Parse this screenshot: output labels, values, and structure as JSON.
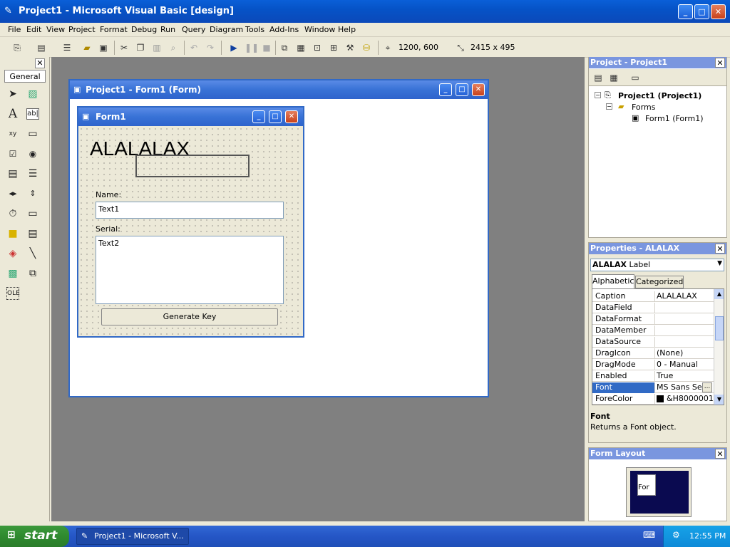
{
  "window": {
    "title": "Project1 - Microsoft Visual Basic [design]"
  },
  "menu": [
    "File",
    "Edit",
    "View",
    "Project",
    "Format",
    "Debug",
    "Run",
    "Query",
    "Diagram",
    "Tools",
    "Add-Ins",
    "Window",
    "Help"
  ],
  "toolbar": {
    "position": "1200, 600",
    "size": "2415 x 495"
  },
  "toolbox": {
    "tab_label": "General"
  },
  "designer": {
    "title": "Project1 - Form1 (Form)"
  },
  "form": {
    "title": "Form1",
    "big_label": "ALALALAX",
    "name_label": "Name:",
    "text1": "Text1",
    "serial_label": "Serial:",
    "text2": "Text2",
    "button": "Generate Key"
  },
  "project_explorer": {
    "title": "Project - Project1",
    "root": "Project1 (Project1)",
    "folder": "Forms",
    "item": "Form1 (Form1)"
  },
  "properties": {
    "title": "Properties - ALALAX",
    "object_name": "ALALAX",
    "object_type": "Label",
    "tab_alpha": "Alphabetic",
    "tab_cat": "Categorized",
    "rows": [
      {
        "name": "Caption",
        "value": "ALALALAX"
      },
      {
        "name": "DataField",
        "value": ""
      },
      {
        "name": "DataFormat",
        "value": ""
      },
      {
        "name": "DataMember",
        "value": ""
      },
      {
        "name": "DataSource",
        "value": ""
      },
      {
        "name": "DragIcon",
        "value": "(None)"
      },
      {
        "name": "DragMode",
        "value": "0 - Manual"
      },
      {
        "name": "Enabled",
        "value": "True"
      },
      {
        "name": "Font",
        "value": "MS Sans Ser"
      },
      {
        "name": "ForeColor",
        "value": "&H8000001"
      }
    ],
    "desc_title": "Font",
    "desc_text": "Returns a Font object."
  },
  "form_layout": {
    "title": "Form Layout",
    "mini_label": "For"
  },
  "taskbar": {
    "start": "start",
    "task": "Project1 - Microsoft V...",
    "clock": "12:55 PM"
  }
}
